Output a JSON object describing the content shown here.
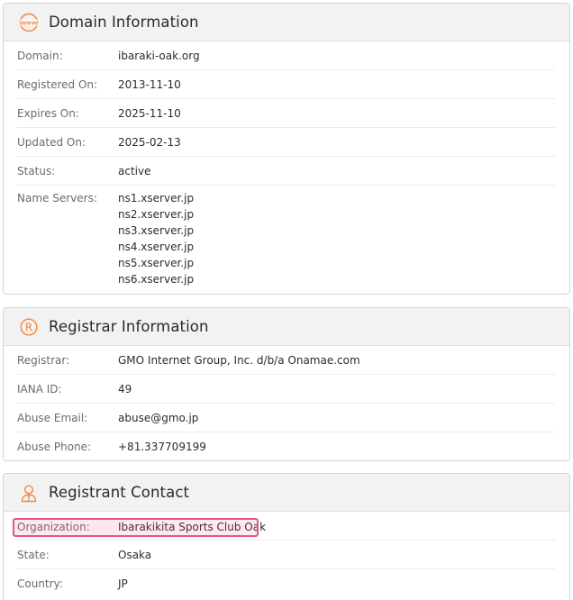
{
  "domain_info": {
    "title": "Domain Information",
    "icon": "www-globe-icon",
    "rows": [
      {
        "label": "Domain:",
        "value": "ibaraki-oak.org"
      },
      {
        "label": "Registered On:",
        "value": "2013-11-10"
      },
      {
        "label": "Expires On:",
        "value": "2025-11-10"
      },
      {
        "label": "Updated On:",
        "value": "2025-02-13"
      },
      {
        "label": "Status:",
        "value": "active"
      }
    ],
    "name_servers": {
      "label": "Name Servers:",
      "values": [
        "ns1.xserver.jp",
        "ns2.xserver.jp",
        "ns3.xserver.jp",
        "ns4.xserver.jp",
        "ns5.xserver.jp",
        "ns6.xserver.jp"
      ]
    }
  },
  "registrar_info": {
    "title": "Registrar Information",
    "icon": "registered-r-icon",
    "rows": [
      {
        "label": "Registrar:",
        "value": "GMO Internet Group, Inc. d/b/a Onamae.com"
      },
      {
        "label": "IANA ID:",
        "value": "49"
      },
      {
        "label": "Abuse Email:",
        "value": "abuse@gmo.jp"
      },
      {
        "label": "Abuse Phone:",
        "value": "+81.337709199"
      }
    ]
  },
  "registrant_contact": {
    "title": "Registrant Contact",
    "icon": "person-icon",
    "rows": [
      {
        "label": "Organization:",
        "value": "Ibarakikita Sports Club Oak"
      },
      {
        "label": "State:",
        "value": "Osaka"
      },
      {
        "label": "Country:",
        "value": "JP"
      }
    ]
  },
  "colors": {
    "accent_orange": "#f0883c",
    "highlight_border": "#e4577e",
    "header_bg": "#f2f2f2"
  }
}
